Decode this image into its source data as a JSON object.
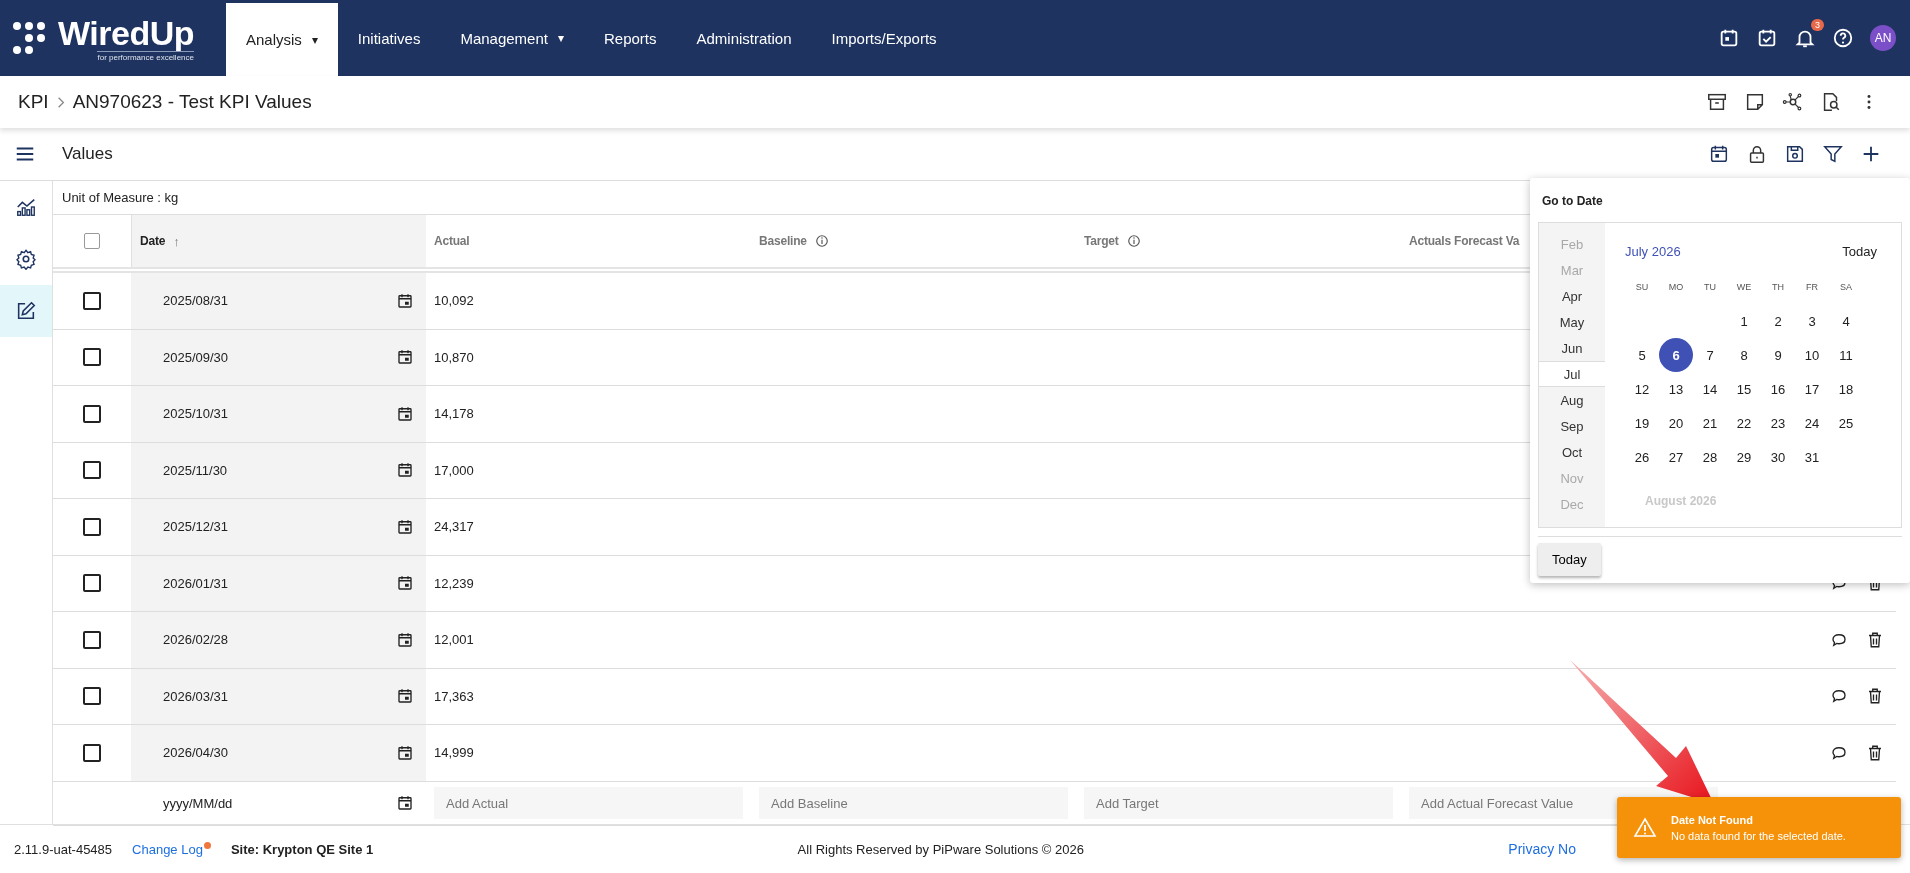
{
  "nav": {
    "logo": {
      "name": "WiredUp",
      "tagline": "for performance excellence"
    },
    "menu": [
      {
        "label": "Analysis",
        "caret": "▾",
        "selected": true
      },
      {
        "label": "Initiatives",
        "selected": false
      },
      {
        "label": "Management",
        "caret": "▾",
        "selected": false
      },
      {
        "label": "Reports",
        "selected": false
      },
      {
        "label": "Administration",
        "selected": false
      },
      {
        "label": "Imports/Exports",
        "selected": false
      }
    ],
    "notifications": "3",
    "avatar": "AN"
  },
  "breadcrumb": [
    "KPI",
    "AN970623 - Test KPI Values"
  ],
  "section": {
    "title": "Values"
  },
  "sidebar": [
    {
      "kind": "chart",
      "selected": false
    },
    {
      "kind": "settings",
      "selected": false
    },
    {
      "kind": "edit",
      "selected": true
    }
  ],
  "unit_of_measure": "Unit of Measure : kg",
  "table": {
    "all_checked": false,
    "columns": [
      {
        "label": "Date",
        "sort_icon": "↑"
      },
      {
        "label": "Actual"
      },
      {
        "label": "Baseline",
        "info": true
      },
      {
        "label": "Target",
        "info": true
      },
      {
        "label": "Actuals Forecast Va"
      }
    ],
    "rows": [
      {
        "date": "2025/08/31",
        "actual": "10,092",
        "checked": false
      },
      {
        "date": "2025/09/30",
        "actual": "10,870",
        "checked": false
      },
      {
        "date": "2025/10/31",
        "actual": "14,178",
        "checked": false
      },
      {
        "date": "2025/11/30",
        "actual": "17,000",
        "checked": false
      },
      {
        "date": "2025/12/31",
        "actual": "24,317",
        "checked": false
      },
      {
        "date": "2026/01/31",
        "actual": "12,239",
        "checked": false
      },
      {
        "date": "2026/02/28",
        "actual": "12,001",
        "checked": false
      },
      {
        "date": "2026/03/31",
        "actual": "17,363",
        "checked": false
      },
      {
        "date": "2026/04/30",
        "actual": "14,999",
        "checked": false
      }
    ],
    "new_row": {
      "date_placeholder": "yyyy/MM/dd",
      "actual_placeholder": "Add Actual",
      "baseline_placeholder": "Add Baseline",
      "target_placeholder": "Add Target",
      "forecast_placeholder": "Add Actual Forecast Value"
    }
  },
  "date_picker": {
    "title": "Go to Date",
    "months": [
      {
        "label": "Feb",
        "dimmed": true,
        "selected": false
      },
      {
        "label": "Mar",
        "dimmed": true,
        "selected": false
      },
      {
        "label": "Apr",
        "dimmed": false,
        "selected": false
      },
      {
        "label": "May",
        "dimmed": false,
        "selected": false
      },
      {
        "label": "Jun",
        "dimmed": false,
        "selected": false
      },
      {
        "label": "Jul",
        "dimmed": false,
        "selected": true
      },
      {
        "label": "Aug",
        "dimmed": false,
        "selected": false
      },
      {
        "label": "Sep",
        "dimmed": false,
        "selected": false
      },
      {
        "label": "Oct",
        "dimmed": false,
        "selected": false
      },
      {
        "label": "Nov",
        "dimmed": true,
        "selected": false
      },
      {
        "label": "Dec",
        "dimmed": true,
        "selected": false
      }
    ],
    "month_title": "July 2026",
    "today_link": "Today",
    "weekdays": [
      "SU",
      "MO",
      "TU",
      "WE",
      "TH",
      "FR",
      "SA"
    ],
    "weeks": [
      {
        "kind": "end",
        "days": [
          {
            "label": "1",
            "selected": false
          },
          {
            "label": "2",
            "selected": false
          },
          {
            "label": "3",
            "selected": false
          },
          {
            "label": "4",
            "selected": false
          }
        ]
      },
      {
        "kind": "full",
        "days": [
          {
            "label": "5",
            "selected": false
          },
          {
            "label": "6",
            "selected": true
          },
          {
            "label": "7",
            "selected": false
          },
          {
            "label": "8",
            "selected": false
          },
          {
            "label": "9",
            "selected": false
          },
          {
            "label": "10",
            "selected": false
          },
          {
            "label": "11",
            "selected": false
          }
        ]
      },
      {
        "kind": "full",
        "days": [
          {
            "label": "12",
            "selected": false
          },
          {
            "label": "13",
            "selected": false
          },
          {
            "label": "14",
            "selected": false
          },
          {
            "label": "15",
            "selected": false
          },
          {
            "label": "16",
            "selected": false
          },
          {
            "label": "17",
            "selected": false
          },
          {
            "label": "18",
            "selected": false
          }
        ]
      },
      {
        "kind": "full",
        "days": [
          {
            "label": "19",
            "selected": false
          },
          {
            "label": "20",
            "selected": false
          },
          {
            "label": "21",
            "selected": false
          },
          {
            "label": "22",
            "selected": false
          },
          {
            "label": "23",
            "selected": false
          },
          {
            "label": "24",
            "selected": false
          },
          {
            "label": "25",
            "selected": false
          }
        ]
      },
      {
        "kind": "start",
        "days": [
          {
            "label": "26",
            "selected": false
          },
          {
            "label": "27",
            "selected": false
          },
          {
            "label": "28",
            "selected": false
          },
          {
            "label": "29",
            "selected": false
          },
          {
            "label": "30",
            "selected": false
          },
          {
            "label": "31",
            "selected": false
          }
        ]
      }
    ],
    "next_month_title": "August 2026",
    "today_button": "Today"
  },
  "footer": {
    "version": "2.11.9-uat-45485",
    "changelog": "Change Log",
    "changelog_dot": true,
    "site": "Site: Krypton QE Site 1",
    "copyright": "All Rights Reserved by PiPware Solutions © 2026",
    "privacy": "Privacy No"
  },
  "toast": {
    "kind": "warning",
    "title": "Date Not Found",
    "message": "No data found for the selected date."
  },
  "annotation": {
    "kind": "arrow"
  }
}
